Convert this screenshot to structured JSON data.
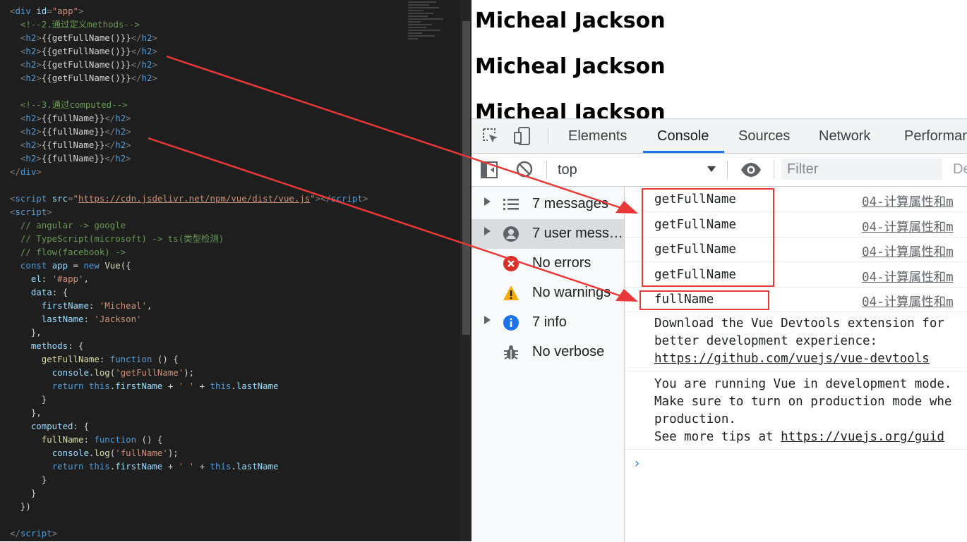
{
  "editor": {
    "lines": [
      [
        [
          "<",
          "tag"
        ],
        [
          "div ",
          "tn"
        ],
        [
          "id",
          "an"
        ],
        [
          "=",
          "tag"
        ],
        [
          "\"app\"",
          "str"
        ],
        [
          ">",
          "tag"
        ]
      ],
      [
        [
          "  <!--2.通过定义methods-->",
          "cm"
        ]
      ],
      [
        [
          "  <",
          "tag"
        ],
        [
          "h2",
          "tn"
        ],
        [
          ">",
          "tag"
        ],
        [
          "{{getFullName()}}",
          "plain"
        ],
        [
          "</",
          "tag"
        ],
        [
          "h2",
          "tn"
        ],
        [
          ">",
          "tag"
        ]
      ],
      [
        [
          "  <",
          "tag"
        ],
        [
          "h2",
          "tn"
        ],
        [
          ">",
          "tag"
        ],
        [
          "{{getFullName()}}",
          "plain"
        ],
        [
          "</",
          "tag"
        ],
        [
          "h2",
          "tn"
        ],
        [
          ">",
          "tag"
        ]
      ],
      [
        [
          "  <",
          "tag"
        ],
        [
          "h2",
          "tn"
        ],
        [
          ">",
          "tag"
        ],
        [
          "{{getFullName()}}",
          "plain"
        ],
        [
          "</",
          "tag"
        ],
        [
          "h2",
          "tn"
        ],
        [
          ">",
          "tag"
        ]
      ],
      [
        [
          "  <",
          "tag"
        ],
        [
          "h2",
          "tn"
        ],
        [
          ">",
          "tag"
        ],
        [
          "{{getFullName()}}",
          "plain"
        ],
        [
          "</",
          "tag"
        ],
        [
          "h2",
          "tn"
        ],
        [
          ">",
          "tag"
        ]
      ],
      [],
      [
        [
          "  <!--3.通过computed-->",
          "cm"
        ]
      ],
      [
        [
          "  <",
          "tag"
        ],
        [
          "h2",
          "tn"
        ],
        [
          ">",
          "tag"
        ],
        [
          "{{fullName}}",
          "plain"
        ],
        [
          "</",
          "tag"
        ],
        [
          "h2",
          "tn"
        ],
        [
          ">",
          "tag"
        ]
      ],
      [
        [
          "  <",
          "tag"
        ],
        [
          "h2",
          "tn"
        ],
        [
          ">",
          "tag"
        ],
        [
          "{{fullName}}",
          "plain"
        ],
        [
          "</",
          "tag"
        ],
        [
          "h2",
          "tn"
        ],
        [
          ">",
          "tag"
        ]
      ],
      [
        [
          "  <",
          "tag"
        ],
        [
          "h2",
          "tn"
        ],
        [
          ">",
          "tag"
        ],
        [
          "{{fullName}}",
          "plain"
        ],
        [
          "</",
          "tag"
        ],
        [
          "h2",
          "tn"
        ],
        [
          ">",
          "tag"
        ]
      ],
      [
        [
          "  <",
          "tag"
        ],
        [
          "h2",
          "tn"
        ],
        [
          ">",
          "tag"
        ],
        [
          "{{fullName}}",
          "plain"
        ],
        [
          "</",
          "tag"
        ],
        [
          "h2",
          "tn"
        ],
        [
          ">",
          "tag"
        ]
      ],
      [
        [
          "</",
          "tag"
        ],
        [
          "div",
          "tn"
        ],
        [
          ">",
          "tag"
        ]
      ],
      [],
      [
        [
          "<",
          "tag"
        ],
        [
          "script ",
          "tn"
        ],
        [
          "src",
          "an"
        ],
        [
          "=",
          "tag"
        ],
        [
          "\"",
          "str"
        ],
        [
          "https://cdn.jsdelivr.net/npm/vue/dist/vue.js",
          "url"
        ],
        [
          "\"",
          "str"
        ],
        [
          "></",
          "tag"
        ],
        [
          "script",
          "tn"
        ],
        [
          ">",
          "tag"
        ]
      ],
      [
        [
          "<",
          "tag"
        ],
        [
          "script",
          "tn"
        ],
        [
          ">",
          "tag"
        ]
      ],
      [
        [
          "  // angular -> google",
          "cm"
        ]
      ],
      [
        [
          "  // TypeScript(microsoft) -> ts(类型检测)",
          "cm"
        ]
      ],
      [
        [
          "  // flow(facebook) ->",
          "cm"
        ]
      ],
      [
        [
          "  ",
          "plain"
        ],
        [
          "const ",
          "kw"
        ],
        [
          "app",
          "prop"
        ],
        [
          " = ",
          "plain"
        ],
        [
          "new ",
          "kw"
        ],
        [
          "Vue",
          "fn"
        ],
        [
          "({",
          "plain"
        ]
      ],
      [
        [
          "    ",
          "plain"
        ],
        [
          "el",
          "prop"
        ],
        [
          ": ",
          "plain"
        ],
        [
          "'#app'",
          "str"
        ],
        [
          ",",
          "plain"
        ]
      ],
      [
        [
          "    ",
          "plain"
        ],
        [
          "data",
          "prop"
        ],
        [
          ": {",
          "plain"
        ]
      ],
      [
        [
          "      ",
          "plain"
        ],
        [
          "firstName",
          "prop"
        ],
        [
          ": ",
          "plain"
        ],
        [
          "'Micheal'",
          "str"
        ],
        [
          ",",
          "plain"
        ]
      ],
      [
        [
          "      ",
          "plain"
        ],
        [
          "lastName",
          "prop"
        ],
        [
          ": ",
          "plain"
        ],
        [
          "'Jackson'",
          "str"
        ]
      ],
      [
        [
          "    },",
          "plain"
        ]
      ],
      [
        [
          "    ",
          "plain"
        ],
        [
          "methods",
          "prop"
        ],
        [
          ": {",
          "plain"
        ]
      ],
      [
        [
          "      ",
          "plain"
        ],
        [
          "getFullName",
          "fn"
        ],
        [
          ": ",
          "plain"
        ],
        [
          "function",
          "kw"
        ],
        [
          " () {",
          "plain"
        ]
      ],
      [
        [
          "        ",
          "plain"
        ],
        [
          "console",
          "prop"
        ],
        [
          ".",
          "plain"
        ],
        [
          "log",
          "fn"
        ],
        [
          "(",
          "plain"
        ],
        [
          "'getFullName'",
          "str"
        ],
        [
          ");",
          "plain"
        ]
      ],
      [
        [
          "        ",
          "plain"
        ],
        [
          "return ",
          "kw"
        ],
        [
          "this",
          "kw"
        ],
        [
          ".",
          "plain"
        ],
        [
          "firstName",
          "prop"
        ],
        [
          " + ",
          "plain"
        ],
        [
          "' '",
          "str"
        ],
        [
          " + ",
          "plain"
        ],
        [
          "this",
          "kw"
        ],
        [
          ".",
          "plain"
        ],
        [
          "lastName",
          "prop"
        ]
      ],
      [
        [
          "      }",
          "plain"
        ]
      ],
      [
        [
          "    },",
          "plain"
        ]
      ],
      [
        [
          "    ",
          "plain"
        ],
        [
          "computed",
          "prop"
        ],
        [
          ": {",
          "plain"
        ]
      ],
      [
        [
          "      ",
          "plain"
        ],
        [
          "fullName",
          "fn"
        ],
        [
          ": ",
          "plain"
        ],
        [
          "function",
          "kw"
        ],
        [
          " () {",
          "plain"
        ]
      ],
      [
        [
          "        ",
          "plain"
        ],
        [
          "console",
          "prop"
        ],
        [
          ".",
          "plain"
        ],
        [
          "log",
          "fn"
        ],
        [
          "(",
          "plain"
        ],
        [
          "'fullName'",
          "str"
        ],
        [
          ");",
          "plain"
        ]
      ],
      [
        [
          "        ",
          "plain"
        ],
        [
          "return ",
          "kw"
        ],
        [
          "this",
          "kw"
        ],
        [
          ".",
          "plain"
        ],
        [
          "firstName",
          "prop"
        ],
        [
          " + ",
          "plain"
        ],
        [
          "' '",
          "str"
        ],
        [
          " + ",
          "plain"
        ],
        [
          "this",
          "kw"
        ],
        [
          ".",
          "plain"
        ],
        [
          "lastName",
          "prop"
        ]
      ],
      [
        [
          "      }",
          "plain"
        ]
      ],
      [
        [
          "    }",
          "plain"
        ]
      ],
      [
        [
          "  })",
          "plain"
        ]
      ],
      [],
      [
        [
          "</",
          "tag"
        ],
        [
          "script",
          "tn"
        ],
        [
          ">",
          "tag"
        ]
      ]
    ]
  },
  "page": {
    "headings": [
      "Micheal Jackson",
      "Micheal Jackson",
      "Micheal Jackson"
    ]
  },
  "devtools": {
    "tabs": {
      "elements": "Elements",
      "console": "Console",
      "sources": "Sources",
      "network": "Network",
      "performance": "Performan"
    },
    "context": "top",
    "filter_placeholder": "Filter",
    "levels_partial": "De",
    "sidebar": [
      {
        "label": "7 messages",
        "icon": "list-icon",
        "expandable": true
      },
      {
        "label": "7 user mess…",
        "icon": "user-icon",
        "expandable": true,
        "selected": true
      },
      {
        "label": "No errors",
        "icon": "error-icon",
        "expandable": false
      },
      {
        "label": "No warnings",
        "icon": "warning-icon",
        "expandable": false
      },
      {
        "label": "7 info",
        "icon": "info-icon",
        "expandable": true
      },
      {
        "label": "No verbose",
        "icon": "bug-icon",
        "expandable": false
      }
    ],
    "logs": [
      {
        "text": "getFullName",
        "source": "04-计算属性和m"
      },
      {
        "text": "getFullName",
        "source": "04-计算属性和m"
      },
      {
        "text": "getFullName",
        "source": "04-计算属性和m"
      },
      {
        "text": "getFullName",
        "source": "04-计算属性和m"
      },
      {
        "text": "fullName",
        "source": "04-计算属性和m"
      }
    ],
    "devtools_msg": {
      "line1": "Download the Vue Devtools extension for",
      "line2": "better development experience:",
      "link": "https://github.com/vuejs/vue-devtools"
    },
    "prod_msg": {
      "line1": "You are running Vue in development mode.",
      "line2": "Make sure to turn on production mode whe",
      "line3": "production.",
      "line4_prefix": "See more tips at ",
      "line4_link": "https://vuejs.org/guid"
    },
    "prompt": "›"
  },
  "colors": {
    "annotation": "#e8383a",
    "accent": "#1a73e8"
  }
}
